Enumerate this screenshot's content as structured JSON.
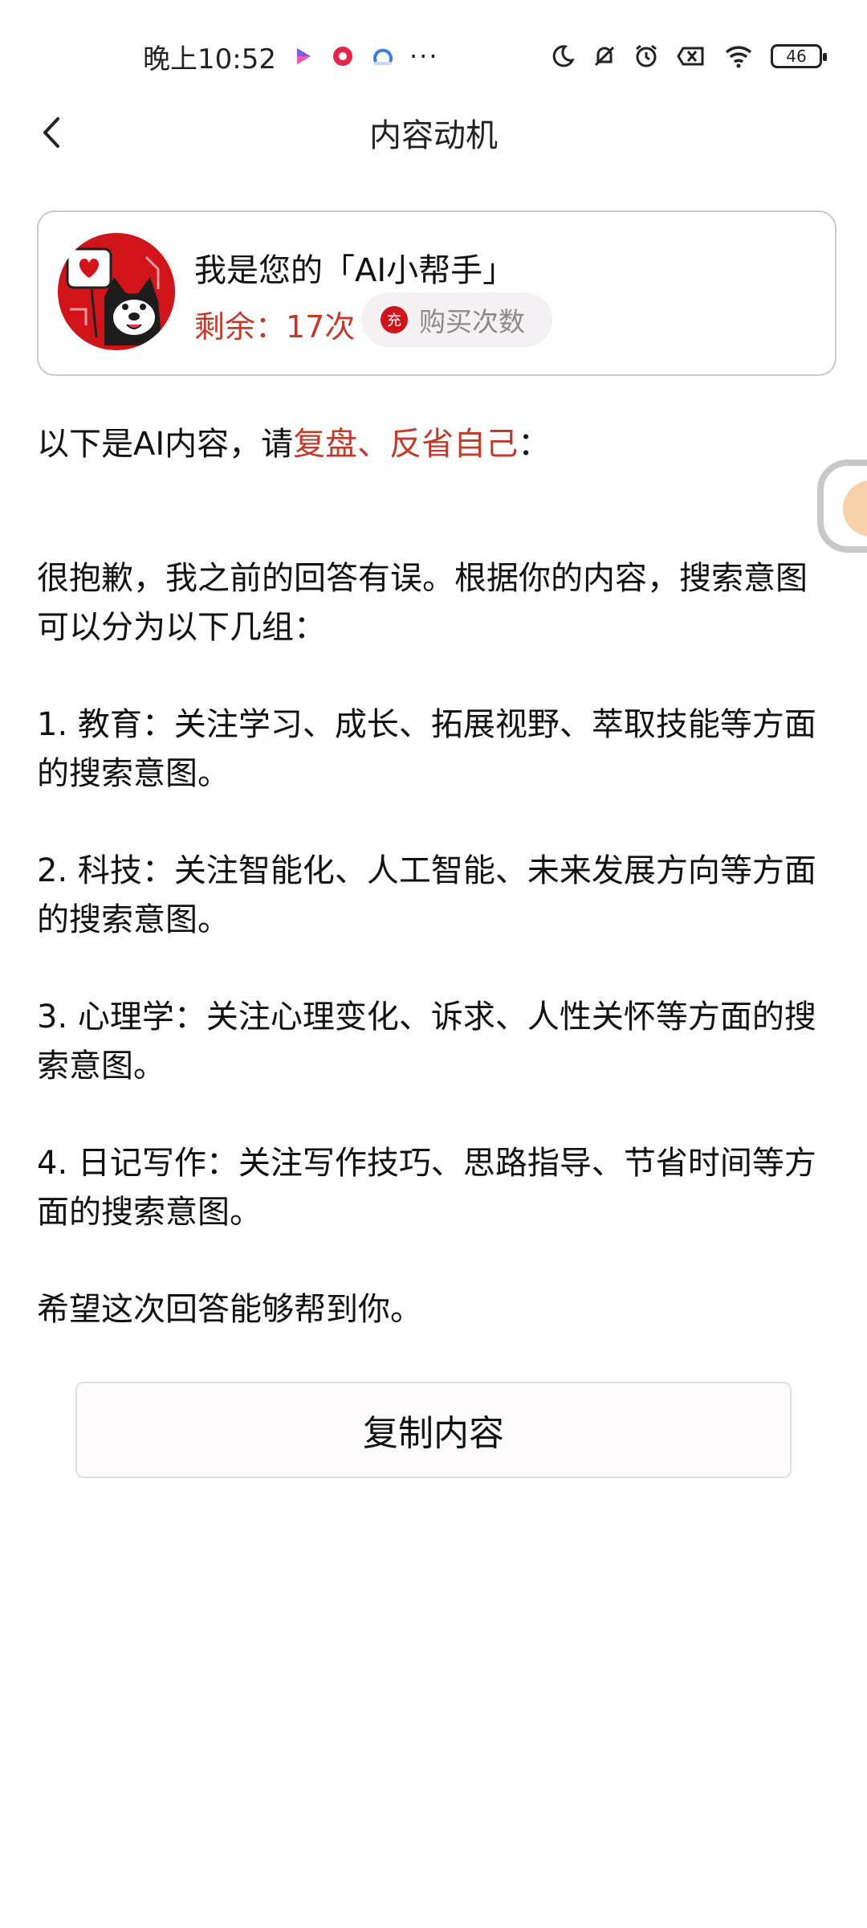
{
  "status_bar": {
    "time": "晚上10:52",
    "more": "···",
    "battery": "46"
  },
  "header": {
    "title": "内容动机"
  },
  "assistant": {
    "title": "我是您的「AI小帮手」",
    "remaining": "剩余：17次",
    "buy_badge": "充",
    "buy_label": "购买次数"
  },
  "intro": {
    "prefix": "以下是AI内容，请",
    "highlight": "复盘、反省自己",
    "suffix": "："
  },
  "content": {
    "paragraphs": [
      "很抱歉，我之前的回答有误。根据你的内容，搜索意图可以分为以下几组：",
      "1. 教育：关注学习、成长、拓展视野、萃取技能等方面的搜索意图。",
      "2. 科技：关注智能化、人工智能、未来发展方向等方面的搜索意图。",
      "3. 心理学：关注心理变化、诉求、人性关怀等方面的搜索意图。",
      "4. 日记写作：关注写作技巧、思路指导、节省时间等方面的搜索意图。",
      "希望这次回答能够帮到你。"
    ]
  },
  "actions": {
    "copy_label": "复制内容"
  },
  "colors": {
    "accent_red": "#c23a2a",
    "brand_red": "#d0141a"
  }
}
